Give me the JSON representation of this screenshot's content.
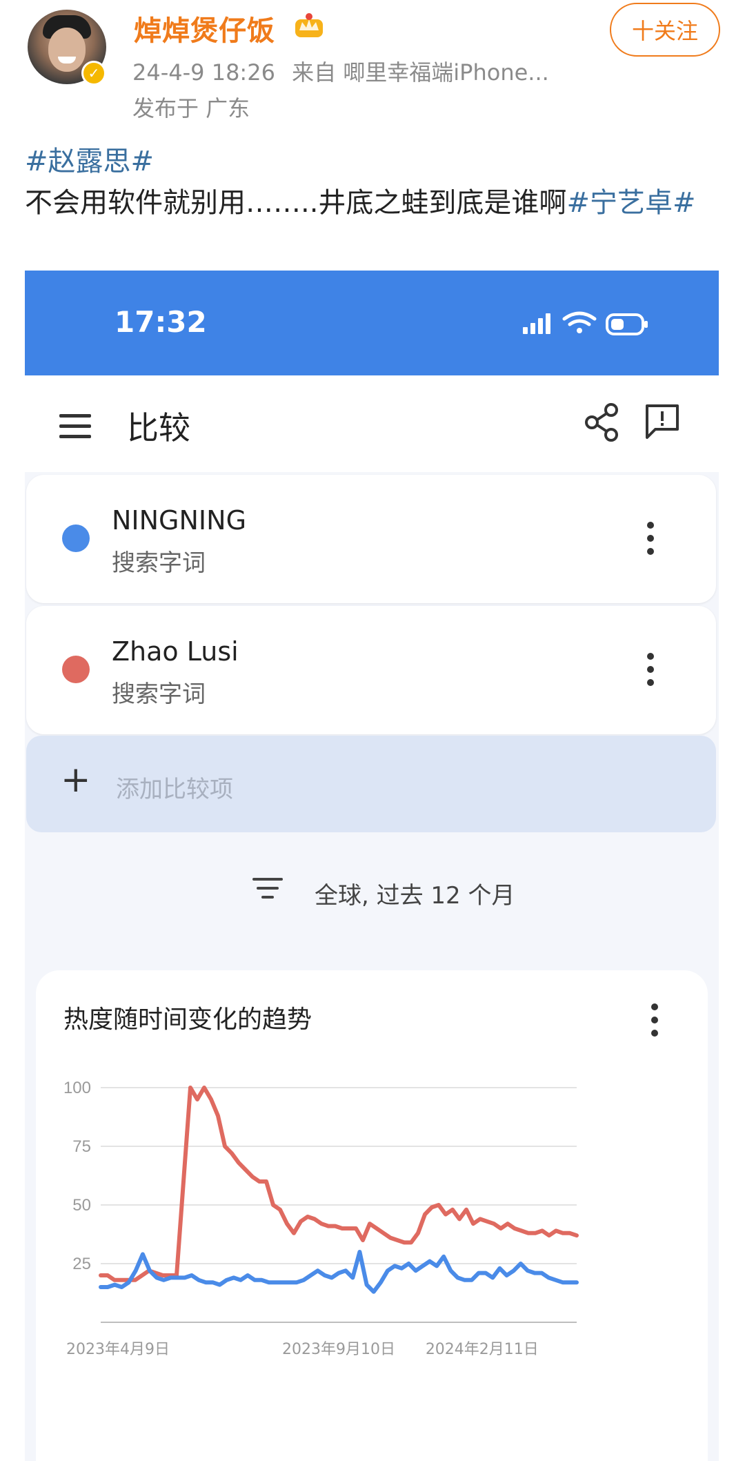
{
  "post": {
    "username": "焯焯煲仔饭",
    "timestamp": "24-4-9 18:26",
    "source": "来自 唧里幸福端iPhone...",
    "location": "发布于 广东",
    "follow_label": "十关注",
    "topic1": "#赵露思#",
    "body": "不会用软件就别用……..井底之蛙到底是谁啊",
    "topic2": "#宁艺卓#"
  },
  "screenshot": {
    "status_time": "17:32",
    "appbar_title": "比较",
    "terms": [
      {
        "name": "NINGNING",
        "sub": "搜索字词",
        "color": "#4a8be8"
      },
      {
        "name": "Zhao Lusi",
        "sub": "搜索字词",
        "color": "#df6a60"
      }
    ],
    "add_label": "添加比较项",
    "filter_text": "全球, 过去 12 个月",
    "chart_title": "热度随时间变化的趋势"
  },
  "chart_data": {
    "type": "line",
    "x_labels": [
      "2023年4月9日",
      "2023年9月10日",
      "2024年2月11日"
    ],
    "ylim": [
      0,
      100
    ],
    "y_ticks": [
      "100",
      "75",
      "50",
      "25"
    ],
    "grid": true,
    "series": [
      {
        "name": "Zhao Lusi",
        "color": "#df6a60",
        "values": [
          20,
          20,
          18,
          18,
          18,
          18,
          20,
          22,
          21,
          20,
          20,
          20,
          60,
          100,
          95,
          100,
          95,
          88,
          75,
          72,
          68,
          65,
          62,
          60,
          60,
          50,
          48,
          42,
          38,
          43,
          45,
          44,
          42,
          41,
          41,
          40,
          40,
          40,
          35,
          42,
          40,
          38,
          36,
          35,
          34,
          34,
          38,
          46,
          49,
          50,
          46,
          48,
          44,
          48,
          42,
          44,
          43,
          42,
          40,
          42,
          40,
          39,
          38,
          38,
          39,
          37,
          39,
          38,
          38,
          37
        ],
        "x_start": 0,
        "x_step": 1
      },
      {
        "name": "NINGNING",
        "color": "#4a8be8",
        "values": [
          15,
          15,
          16,
          15,
          17,
          22,
          29,
          22,
          19,
          18,
          19,
          19,
          19,
          20,
          18,
          17,
          17,
          16,
          18,
          19,
          18,
          20,
          18,
          18,
          17,
          17,
          17,
          17,
          17,
          18,
          20,
          22,
          20,
          19,
          21,
          22,
          19,
          30,
          16,
          13,
          17,
          22,
          24,
          23,
          25,
          22,
          24,
          26,
          24,
          28,
          22,
          19,
          18,
          18,
          21,
          21,
          19,
          23,
          20,
          22,
          25,
          22,
          21,
          21,
          19,
          18,
          17,
          17,
          17
        ],
        "x_start": 0,
        "x_step": 1
      }
    ]
  }
}
